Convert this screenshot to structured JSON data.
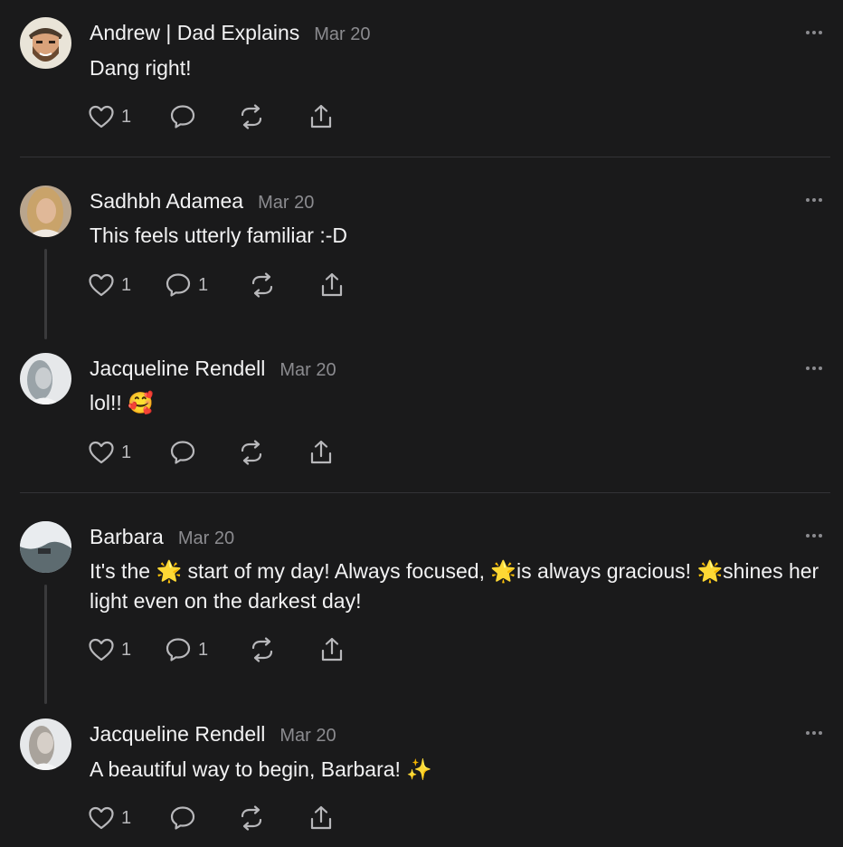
{
  "posts": [
    {
      "author": "Andrew | Dad Explains",
      "date": "Mar 20",
      "text": "Dang right!",
      "likes": "1",
      "replies": "",
      "avatar": "cartoon-avatar",
      "thread": false
    },
    {
      "author": "Sadhbh Adamea",
      "date": "Mar 20",
      "text": "This feels utterly familiar :-D",
      "likes": "1",
      "replies": "1",
      "avatar": "photo-avatar",
      "thread": true
    },
    {
      "author": "Jacqueline Rendell",
      "date": "Mar 20",
      "text": "lol!! 🥰",
      "likes": "1",
      "replies": "",
      "avatar": "photo-avatar",
      "thread": false
    },
    {
      "author": "Barbara",
      "date": "Mar 20",
      "text_parts": [
        "It's the ",
        "🌟",
        " start of my day! Always focused, ",
        "🌟",
        "is always gracious! ",
        "🌟",
        "shines her light even on the darkest day!"
      ],
      "likes": "1",
      "replies": "1",
      "avatar": "photo-avatar",
      "thread": true
    },
    {
      "author": "Jacqueline Rendell",
      "date": "Mar 20",
      "text_parts": [
        "A beautiful way to begin, Barbara! ",
        "✨"
      ],
      "likes": "1",
      "replies": "",
      "avatar": "photo-avatar",
      "thread": false
    }
  ],
  "colors": {
    "background": "#1a1a1b",
    "text": "#f2f2f3",
    "muted": "#8b8b8f",
    "divider": "#333336",
    "thread_line": "#3a3a3c"
  },
  "icons": [
    "heart-icon",
    "comment-icon",
    "restack-icon",
    "share-icon",
    "more-icon"
  ]
}
